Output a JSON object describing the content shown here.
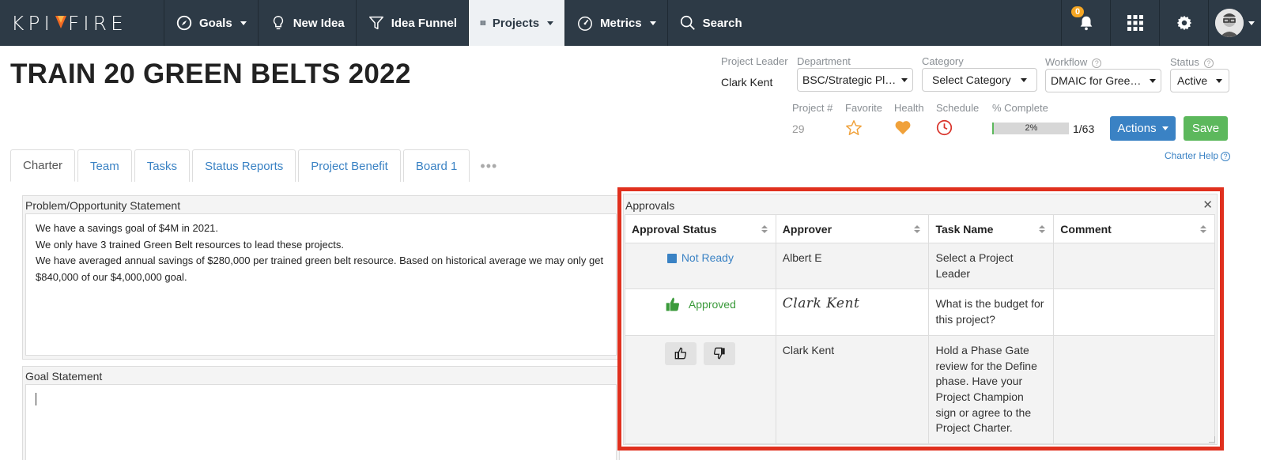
{
  "nav": {
    "logo_left": "KPI",
    "logo_right": "FIRE",
    "items": [
      {
        "label": "Goals",
        "icon": "compass-icon",
        "dropdown": true
      },
      {
        "label": "New Idea",
        "icon": "lightbulb-icon",
        "dropdown": false
      },
      {
        "label": "Idea Funnel",
        "icon": "funnel-icon",
        "dropdown": false
      },
      {
        "label": "Projects",
        "icon": "projects-icon",
        "dropdown": true,
        "active": true
      },
      {
        "label": "Metrics",
        "icon": "gauge-icon",
        "dropdown": true
      },
      {
        "label": "Search",
        "icon": "search-icon",
        "dropdown": false
      }
    ],
    "notification_count": "0"
  },
  "project": {
    "title": "TRAIN 20 GREEN BELTS 2022",
    "leader_label": "Project Leader",
    "leader_value": "Clark Kent",
    "department_label": "Department",
    "department_value": "BSC/Strategic Pl…",
    "category_label": "Category",
    "category_value": "Select Category",
    "workflow_label": "Workflow",
    "workflow_value": "DMAIC for Gree…",
    "status_label": "Status",
    "status_value": "Active",
    "number_label": "Project #",
    "number_value": "29",
    "favorite_label": "Favorite",
    "health_label": "Health",
    "schedule_label": "Schedule",
    "complete_label": "% Complete",
    "complete_text": "2%",
    "complete_fraction": 0.02,
    "task_ratio": "1/63",
    "actions_label": "Actions",
    "save_label": "Save",
    "charter_help": "Charter Help"
  },
  "tabs": [
    "Charter",
    "Team",
    "Tasks",
    "Status Reports",
    "Project Benefit",
    "Board 1"
  ],
  "problem": {
    "title": "Problem/Opportunity Statement",
    "lines": [
      "We have a savings goal of $4M in 2021.",
      "We only have 3 trained Green Belt resources to lead these projects.",
      "We have averaged annual savings of $280,000 per trained green belt resource. Based on historical average we may only get $840,000 of our $4,000,000 goal."
    ]
  },
  "goal": {
    "title": "Goal Statement"
  },
  "approvals": {
    "title": "Approvals",
    "columns": [
      "Approval Status",
      "Approver",
      "Task Name",
      "Comment"
    ],
    "rows": [
      {
        "status": "Not Ready",
        "approver": "Albert E",
        "task": "Select a Project Leader",
        "comment": ""
      },
      {
        "status": "Approved",
        "approver": "Clark Kent",
        "task": "What is the budget for this project?",
        "comment": ""
      },
      {
        "status": "",
        "approver": "Clark Kent",
        "task": "Hold a Phase Gate review for the Define phase. Have your Project Champion sign or agree to the Project Charter.",
        "comment": ""
      }
    ]
  },
  "colors": {
    "nav_bg": "#2d3a46",
    "accent_blue": "#3a82c4",
    "save_green": "#5cb85c",
    "highlight_red": "#e0301e",
    "health_orange": "#f0a13a",
    "schedule_red": "#d9342b"
  }
}
